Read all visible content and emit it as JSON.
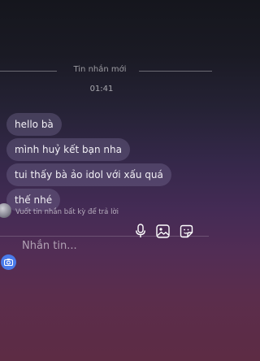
{
  "thread": {
    "divider_label": "Tin nhắn mới",
    "timestamp": "01:41",
    "messages": [
      {
        "text": "hello bà"
      },
      {
        "text": "mình huỷ kết bạn nha"
      },
      {
        "text": "tui thấy bà ảo idol với xấu quá"
      },
      {
        "text": "thế nhé"
      }
    ],
    "reply_hint": "Vuốt tin nhắn bất kỳ để trả lời"
  },
  "composer": {
    "placeholder": "Nhắn tin...",
    "icons": {
      "camera": "camera-icon",
      "mic": "microphone-icon",
      "gallery": "image-icon",
      "sticker": "sticker-icon"
    },
    "accent_color": "#4a7bea"
  }
}
